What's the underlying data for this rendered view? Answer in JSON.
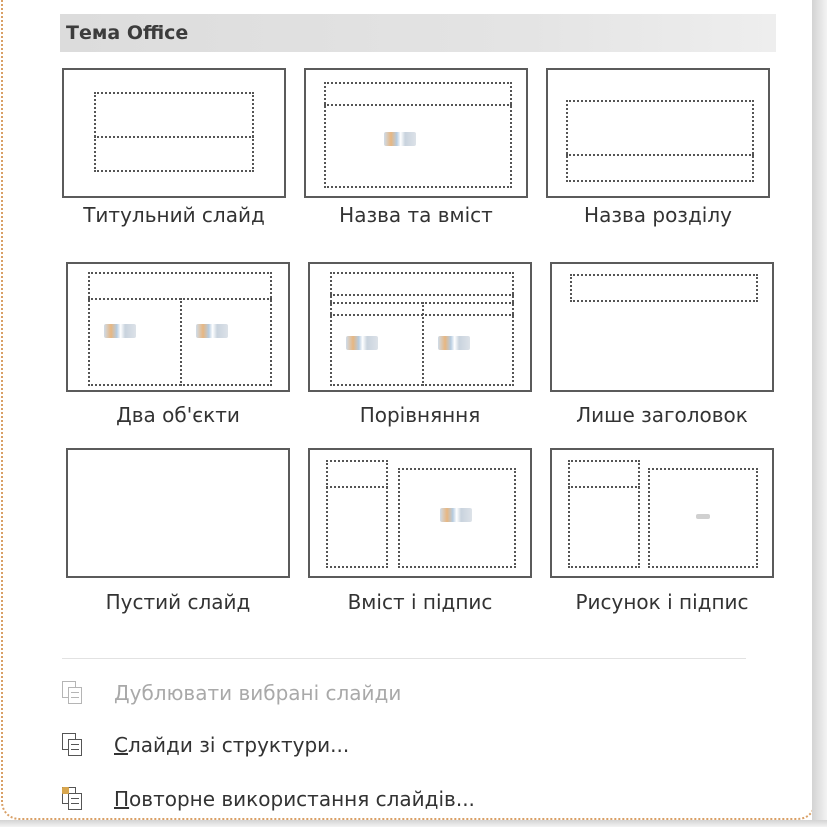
{
  "section": {
    "title": "Тема Office"
  },
  "layouts": [
    {
      "label": "Титульний слайд"
    },
    {
      "label": "Назва та вміст"
    },
    {
      "label": "Назва розділу"
    },
    {
      "label": "Два об'єкти"
    },
    {
      "label": "Порівняння"
    },
    {
      "label": "Лише заголовок"
    },
    {
      "label": "Пустий слайд"
    },
    {
      "label": "Вміст і підпис"
    },
    {
      "label": "Рисунок і підпис"
    }
  ],
  "commands": [
    {
      "accel": "Д",
      "rest": "ублювати вибрані слайди",
      "enabled": false,
      "icon": "duplicate-slides-icon"
    },
    {
      "accel": "С",
      "rest": "лайди зі структури...",
      "enabled": true,
      "icon": "slides-from-outline-icon"
    },
    {
      "accel": "П",
      "rest": "овторне використання слайдів...",
      "enabled": true,
      "icon": "reuse-slides-icon"
    }
  ],
  "colors": {
    "frame_border": "#d9a066",
    "header_bg": "#dcdcdc",
    "thumb_border": "#5b5b5b",
    "disabled_text": "#a9a9a9"
  }
}
